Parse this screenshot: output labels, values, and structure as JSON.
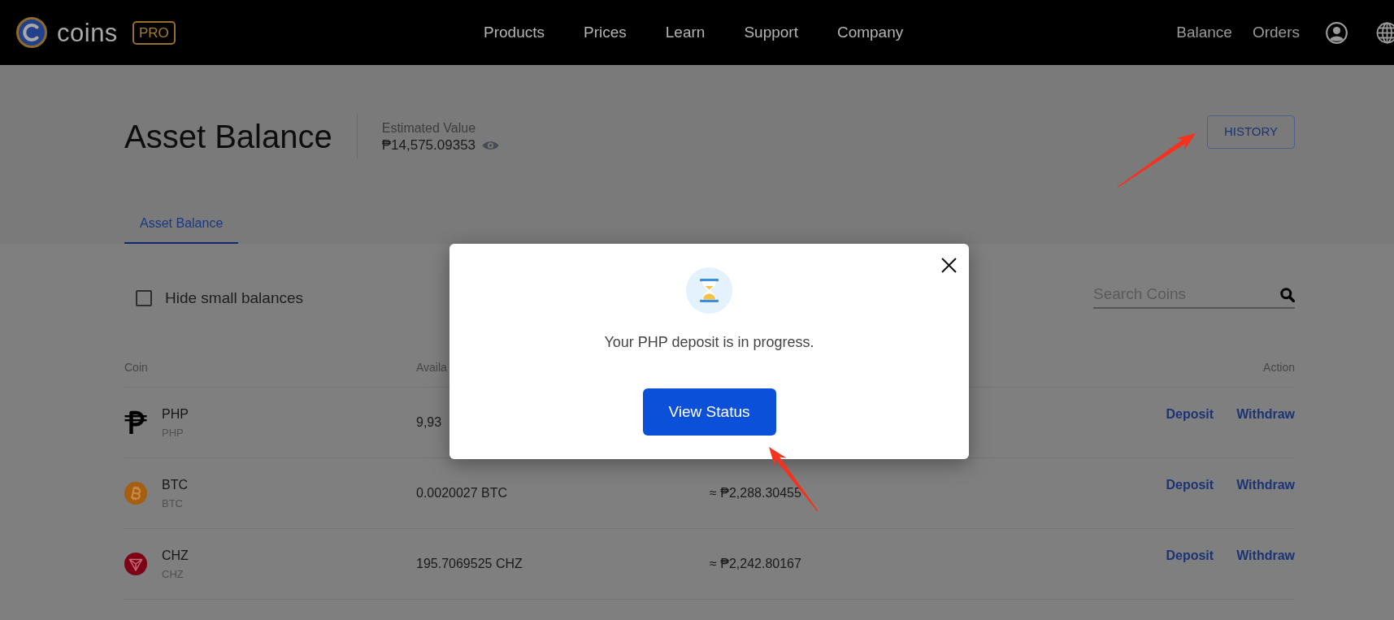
{
  "navbar": {
    "logo_text": "coins",
    "logo_badge": "PRO",
    "menu": [
      "Products",
      "Prices",
      "Learn",
      "Support",
      "Company"
    ],
    "links": [
      "Balance",
      "Orders"
    ]
  },
  "header": {
    "title": "Asset Balance",
    "estimate_label": "Estimated Value",
    "estimate_value": "₱14,575.09353",
    "history_button": "HISTORY"
  },
  "tabs": [
    {
      "label": "Asset Balance",
      "selected": true
    }
  ],
  "filters": {
    "hide_small_balances": {
      "label": "Hide small balances",
      "checked": false
    },
    "search": {
      "placeholder": "Search Coins"
    }
  },
  "table": {
    "columns": {
      "coin": "Coin",
      "column_2": "Availa",
      "action": "Action"
    },
    "rows": [
      {
        "name": "PHP",
        "code": "PHP",
        "available": "9,93",
        "actions": [
          "Deposit",
          "Withdraw"
        ]
      },
      {
        "name": "BTC",
        "code": "BTC",
        "available": "0.0020027 BTC",
        "column_3": "≈ ₱2,288.30455",
        "actions": [
          "Deposit",
          "Withdraw"
        ]
      },
      {
        "name": "CHZ",
        "code": "CHZ",
        "available": "195.7069525 CHZ",
        "column_3": "≈ ₱2,242.80167",
        "actions": [
          "Deposit",
          "Withdraw"
        ]
      }
    ]
  },
  "modal": {
    "message": "Your PHP deposit is in progress.",
    "button": "View Status"
  }
}
